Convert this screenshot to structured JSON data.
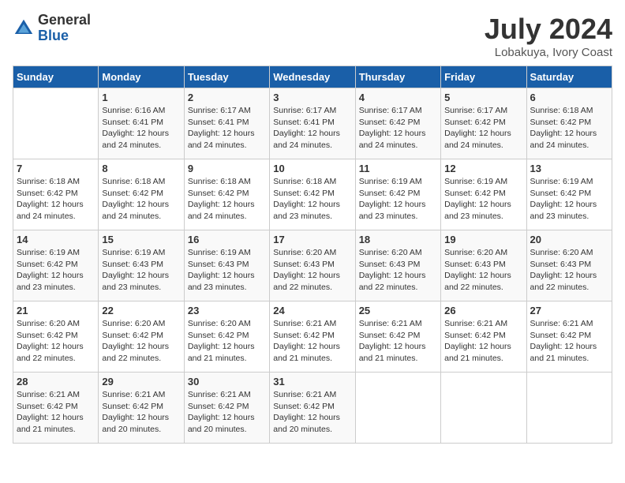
{
  "logo": {
    "general": "General",
    "blue": "Blue"
  },
  "title": {
    "month_year": "July 2024",
    "location": "Lobakuya, Ivory Coast"
  },
  "days_header": [
    "Sunday",
    "Monday",
    "Tuesday",
    "Wednesday",
    "Thursday",
    "Friday",
    "Saturday"
  ],
  "weeks": [
    [
      {
        "day": "",
        "sunrise": "",
        "sunset": "",
        "daylight": ""
      },
      {
        "day": "1",
        "sunrise": "Sunrise: 6:16 AM",
        "sunset": "Sunset: 6:41 PM",
        "daylight": "Daylight: 12 hours and 24 minutes."
      },
      {
        "day": "2",
        "sunrise": "Sunrise: 6:17 AM",
        "sunset": "Sunset: 6:41 PM",
        "daylight": "Daylight: 12 hours and 24 minutes."
      },
      {
        "day": "3",
        "sunrise": "Sunrise: 6:17 AM",
        "sunset": "Sunset: 6:41 PM",
        "daylight": "Daylight: 12 hours and 24 minutes."
      },
      {
        "day": "4",
        "sunrise": "Sunrise: 6:17 AM",
        "sunset": "Sunset: 6:42 PM",
        "daylight": "Daylight: 12 hours and 24 minutes."
      },
      {
        "day": "5",
        "sunrise": "Sunrise: 6:17 AM",
        "sunset": "Sunset: 6:42 PM",
        "daylight": "Daylight: 12 hours and 24 minutes."
      },
      {
        "day": "6",
        "sunrise": "Sunrise: 6:18 AM",
        "sunset": "Sunset: 6:42 PM",
        "daylight": "Daylight: 12 hours and 24 minutes."
      }
    ],
    [
      {
        "day": "7",
        "sunrise": "Sunrise: 6:18 AM",
        "sunset": "Sunset: 6:42 PM",
        "daylight": "Daylight: 12 hours and 24 minutes."
      },
      {
        "day": "8",
        "sunrise": "Sunrise: 6:18 AM",
        "sunset": "Sunset: 6:42 PM",
        "daylight": "Daylight: 12 hours and 24 minutes."
      },
      {
        "day": "9",
        "sunrise": "Sunrise: 6:18 AM",
        "sunset": "Sunset: 6:42 PM",
        "daylight": "Daylight: 12 hours and 24 minutes."
      },
      {
        "day": "10",
        "sunrise": "Sunrise: 6:18 AM",
        "sunset": "Sunset: 6:42 PM",
        "daylight": "Daylight: 12 hours and 23 minutes."
      },
      {
        "day": "11",
        "sunrise": "Sunrise: 6:19 AM",
        "sunset": "Sunset: 6:42 PM",
        "daylight": "Daylight: 12 hours and 23 minutes."
      },
      {
        "day": "12",
        "sunrise": "Sunrise: 6:19 AM",
        "sunset": "Sunset: 6:42 PM",
        "daylight": "Daylight: 12 hours and 23 minutes."
      },
      {
        "day": "13",
        "sunrise": "Sunrise: 6:19 AM",
        "sunset": "Sunset: 6:42 PM",
        "daylight": "Daylight: 12 hours and 23 minutes."
      }
    ],
    [
      {
        "day": "14",
        "sunrise": "Sunrise: 6:19 AM",
        "sunset": "Sunset: 6:42 PM",
        "daylight": "Daylight: 12 hours and 23 minutes."
      },
      {
        "day": "15",
        "sunrise": "Sunrise: 6:19 AM",
        "sunset": "Sunset: 6:43 PM",
        "daylight": "Daylight: 12 hours and 23 minutes."
      },
      {
        "day": "16",
        "sunrise": "Sunrise: 6:19 AM",
        "sunset": "Sunset: 6:43 PM",
        "daylight": "Daylight: 12 hours and 23 minutes."
      },
      {
        "day": "17",
        "sunrise": "Sunrise: 6:20 AM",
        "sunset": "Sunset: 6:43 PM",
        "daylight": "Daylight: 12 hours and 22 minutes."
      },
      {
        "day": "18",
        "sunrise": "Sunrise: 6:20 AM",
        "sunset": "Sunset: 6:43 PM",
        "daylight": "Daylight: 12 hours and 22 minutes."
      },
      {
        "day": "19",
        "sunrise": "Sunrise: 6:20 AM",
        "sunset": "Sunset: 6:43 PM",
        "daylight": "Daylight: 12 hours and 22 minutes."
      },
      {
        "day": "20",
        "sunrise": "Sunrise: 6:20 AM",
        "sunset": "Sunset: 6:43 PM",
        "daylight": "Daylight: 12 hours and 22 minutes."
      }
    ],
    [
      {
        "day": "21",
        "sunrise": "Sunrise: 6:20 AM",
        "sunset": "Sunset: 6:42 PM",
        "daylight": "Daylight: 12 hours and 22 minutes."
      },
      {
        "day": "22",
        "sunrise": "Sunrise: 6:20 AM",
        "sunset": "Sunset: 6:42 PM",
        "daylight": "Daylight: 12 hours and 22 minutes."
      },
      {
        "day": "23",
        "sunrise": "Sunrise: 6:20 AM",
        "sunset": "Sunset: 6:42 PM",
        "daylight": "Daylight: 12 hours and 21 minutes."
      },
      {
        "day": "24",
        "sunrise": "Sunrise: 6:21 AM",
        "sunset": "Sunset: 6:42 PM",
        "daylight": "Daylight: 12 hours and 21 minutes."
      },
      {
        "day": "25",
        "sunrise": "Sunrise: 6:21 AM",
        "sunset": "Sunset: 6:42 PM",
        "daylight": "Daylight: 12 hours and 21 minutes."
      },
      {
        "day": "26",
        "sunrise": "Sunrise: 6:21 AM",
        "sunset": "Sunset: 6:42 PM",
        "daylight": "Daylight: 12 hours and 21 minutes."
      },
      {
        "day": "27",
        "sunrise": "Sunrise: 6:21 AM",
        "sunset": "Sunset: 6:42 PM",
        "daylight": "Daylight: 12 hours and 21 minutes."
      }
    ],
    [
      {
        "day": "28",
        "sunrise": "Sunrise: 6:21 AM",
        "sunset": "Sunset: 6:42 PM",
        "daylight": "Daylight: 12 hours and 21 minutes."
      },
      {
        "day": "29",
        "sunrise": "Sunrise: 6:21 AM",
        "sunset": "Sunset: 6:42 PM",
        "daylight": "Daylight: 12 hours and 20 minutes."
      },
      {
        "day": "30",
        "sunrise": "Sunrise: 6:21 AM",
        "sunset": "Sunset: 6:42 PM",
        "daylight": "Daylight: 12 hours and 20 minutes."
      },
      {
        "day": "31",
        "sunrise": "Sunrise: 6:21 AM",
        "sunset": "Sunset: 6:42 PM",
        "daylight": "Daylight: 12 hours and 20 minutes."
      },
      {
        "day": "",
        "sunrise": "",
        "sunset": "",
        "daylight": ""
      },
      {
        "day": "",
        "sunrise": "",
        "sunset": "",
        "daylight": ""
      },
      {
        "day": "",
        "sunrise": "",
        "sunset": "",
        "daylight": ""
      }
    ]
  ]
}
